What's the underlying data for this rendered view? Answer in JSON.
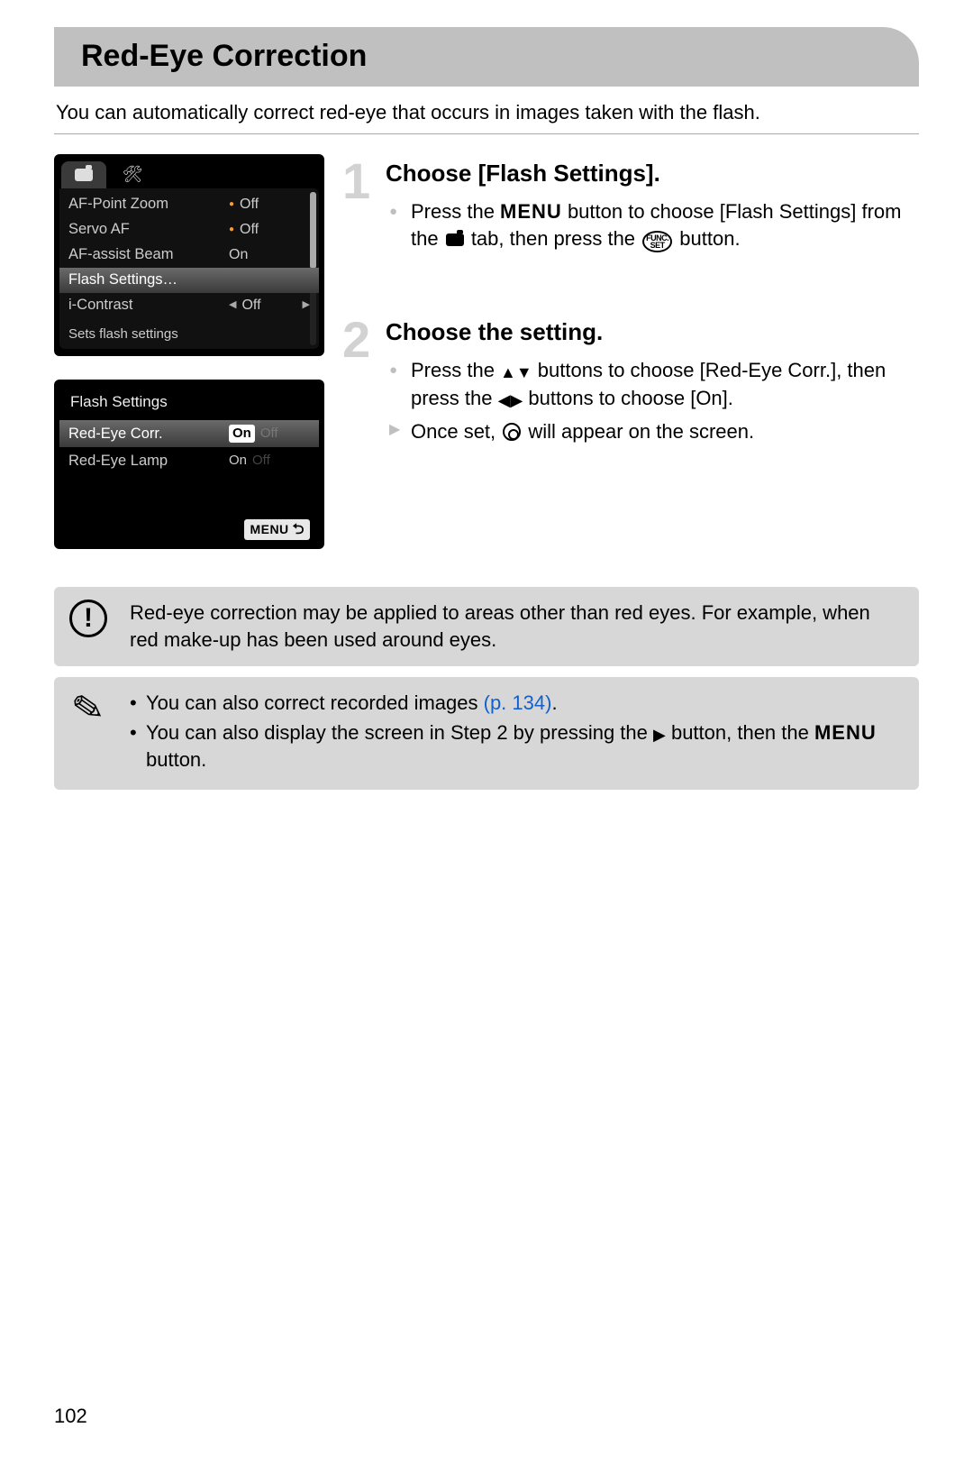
{
  "page": {
    "number": "102",
    "title": "Red-Eye Correction",
    "intro": "You can automatically correct red-eye that occurs in images taken with the flash."
  },
  "menu_screen": {
    "items": [
      {
        "label": "AF-Point Zoom",
        "value": "Off",
        "on_dot": true
      },
      {
        "label": "Servo AF",
        "value": "Off",
        "on_dot": true
      },
      {
        "label": "AF-assist Beam",
        "value": "On",
        "on_dot": false
      },
      {
        "label": "Flash Settings…",
        "value": "",
        "selected": true
      },
      {
        "label": "i-Contrast",
        "value": "Off",
        "arrows": true
      }
    ],
    "hint": "Sets flash settings"
  },
  "flash_screen": {
    "title": "Flash Settings",
    "items": [
      {
        "label": "Red-Eye Corr.",
        "value_on": "On",
        "value_off": "Off",
        "selected": true
      },
      {
        "label": "Red-Eye Lamp",
        "value_on": "On",
        "value_off": "Off",
        "selected": false
      }
    ],
    "footer": "MENU"
  },
  "steps": {
    "s1": {
      "num": "1",
      "heading": "Choose [Flash Settings].",
      "line1a": "Press the ",
      "line1_menu": "MENU",
      "line1b": " button to choose [Flash Settings] from the ",
      "line1c": " tab, then press the ",
      "line1_func1": "FUNC.",
      "line1_func2": "SET",
      "line1d": " button."
    },
    "s2": {
      "num": "2",
      "heading": "Choose the setting.",
      "line1a": "Press the ",
      "line1_arrows_v": "▲▼",
      "line1b": " buttons to choose [Red-Eye Corr.], then press the ",
      "line1_arrows_h": "◀▶",
      "line1c": " buttons to choose [On].",
      "line2a": "Once set, ",
      "line2b": " will appear on the screen."
    }
  },
  "caution": {
    "text": "Red-eye correction may be applied to areas other than red eyes. For example, when red make-up has been used around eyes."
  },
  "note": {
    "bullet1a": "You can also correct recorded images ",
    "bullet1_link": "(p. 134)",
    "bullet1b": ".",
    "bullet2a": "You can also display the screen in Step 2 by pressing the ",
    "bullet2_arrow": "▶",
    "bullet2b": " button, then the ",
    "bullet2_menu": "MENU",
    "bullet2c": " button."
  }
}
